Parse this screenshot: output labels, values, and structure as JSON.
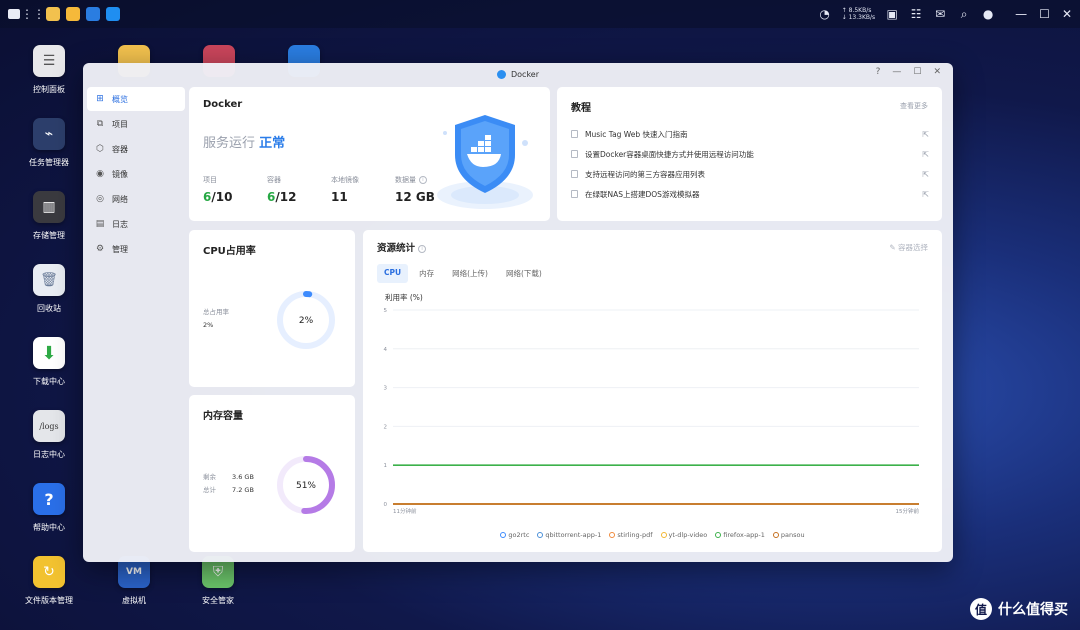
{
  "topbar": {
    "speed_up": "↑ 8.5KB/s",
    "speed_down": "↓ 13.3KB/s"
  },
  "desktop_icons": [
    {
      "label": "控制面板",
      "color": "#e8e8ea",
      "glyph": "☰"
    },
    {
      "label": "任务管理器",
      "color": "#2c3e6b",
      "glyph": "⌁"
    },
    {
      "label": "存储管理",
      "color": "#3a3a3f",
      "glyph": "▥"
    },
    {
      "label": "回收站",
      "color": "#e9edf3",
      "glyph": "🗑"
    },
    {
      "label": "下载中心",
      "color": "#ffffff",
      "glyph": "⬇"
    },
    {
      "label": "日志中心",
      "color": "#e4e6ea",
      "glyph": "/logs"
    },
    {
      "label": "帮助中心",
      "color": "#2a6fe8",
      "glyph": "?"
    },
    {
      "label": "文件版本管理",
      "color": "#f2c230",
      "glyph": "↻"
    },
    {
      "label": "虚拟机",
      "color": "#2b63c9",
      "glyph": "VM"
    },
    {
      "label": "安全管家",
      "color": "#6bc46a",
      "glyph": "⛨"
    }
  ],
  "window": {
    "title": "Docker",
    "help": "?",
    "minimize": "—",
    "maximize": "☐",
    "close": "✕"
  },
  "sidebar": {
    "items": [
      {
        "label": "概览",
        "icon": "grid-icon",
        "glyph": "⊞"
      },
      {
        "label": "项目",
        "icon": "project-icon",
        "glyph": "⧉"
      },
      {
        "label": "容器",
        "icon": "cube-icon",
        "glyph": "⬡"
      },
      {
        "label": "镜像",
        "icon": "disc-icon",
        "glyph": "◉"
      },
      {
        "label": "网络",
        "icon": "globe-icon",
        "glyph": "◎"
      },
      {
        "label": "日志",
        "icon": "log-icon",
        "glyph": "▤"
      },
      {
        "label": "管理",
        "icon": "gear-icon",
        "glyph": "⚙"
      }
    ]
  },
  "summary": {
    "title": "Docker",
    "status_prefix": "服务运行",
    "status_value": "正常",
    "stats": [
      {
        "label": "项目",
        "value_green": "6",
        "value_rest": "/10"
      },
      {
        "label": "容器",
        "value_green": "6",
        "value_rest": "/12"
      },
      {
        "label": "本地镜像",
        "value_green": "",
        "value_rest": "11"
      },
      {
        "label": "数据量",
        "value_green": "",
        "value_rest": "12 GB"
      }
    ]
  },
  "tutorial": {
    "title": "教程",
    "more": "查看更多",
    "items": [
      "Music Tag Web 快速入门指南",
      "设置Docker容器桌面快捷方式并使用远程访问功能",
      "支持远程访问的第三方容器应用列表",
      "在绿联NAS上搭建DOS游戏模拟器"
    ]
  },
  "cpu": {
    "title": "CPU占用率",
    "label": "总占用率",
    "value": "2%",
    "center": "2%",
    "fraction": 0.02,
    "color": "#3d8bfd",
    "track_color": "#e6efff"
  },
  "memory": {
    "title": "内存容量",
    "used_label": "剩余",
    "used_value": "3.6 GB",
    "total_label": "总计",
    "total_value": "7.2 GB",
    "center": "51%",
    "fraction": 0.51,
    "color": "#b57be6",
    "track_color": "#f2eafb"
  },
  "resources": {
    "title": "资源统计",
    "info": "i",
    "choose": "容器选择",
    "tabs": [
      "CPU",
      "内存",
      "网络(上传)",
      "网络(下载)"
    ],
    "active_tab": 0
  },
  "chart_data": {
    "type": "line",
    "ylabel": "利用率 (%)",
    "y_ticks": [
      "5",
      "4",
      "3",
      "2",
      "1",
      "0"
    ],
    "ylim": [
      0,
      5
    ],
    "x_start_label": "11分钟前",
    "x_end_label": "15分钟前",
    "grid": true,
    "legend_position": "bottom",
    "series": [
      {
        "name": "go2rtc",
        "color": "#3d8bfd",
        "values": [
          0,
          0
        ]
      },
      {
        "name": "qbittorrent-app-1",
        "color": "#4a90d9",
        "values": [
          0,
          0
        ]
      },
      {
        "name": "stirling-pdf",
        "color": "#f08a3c",
        "values": [
          0,
          0
        ]
      },
      {
        "name": "yt-dlp-video",
        "color": "#f2b632",
        "values": [
          0,
          0
        ]
      },
      {
        "name": "firefox-app-1",
        "color": "#3cb14a",
        "values": [
          1,
          1
        ]
      },
      {
        "name": "pansou",
        "color": "#c5701f",
        "values": [
          0,
          0
        ]
      }
    ]
  },
  "watermark": {
    "glyph": "值",
    "text": "什么值得买"
  }
}
